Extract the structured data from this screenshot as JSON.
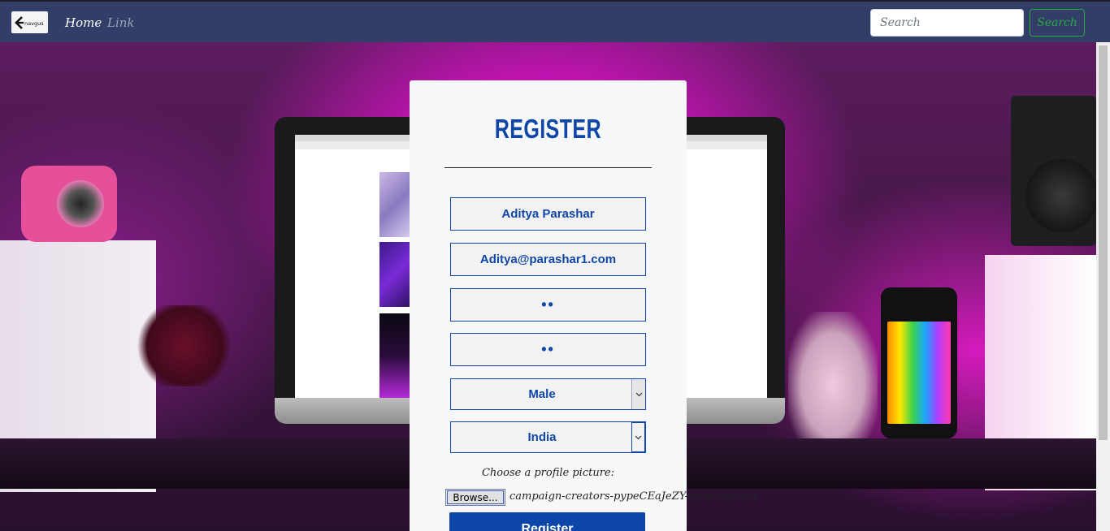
{
  "navbar": {
    "brand_text": "navgus",
    "home_label": "Home",
    "link_label": "Link",
    "search_placeholder": "Search",
    "search_button": "Search"
  },
  "form": {
    "title": "Register",
    "name_value": "Aditya Parashar",
    "email_value": "Aditya@parashar1.com",
    "password_mask": "••",
    "confirm_password_mask": "••",
    "gender_selected": "Male",
    "country_selected": "India",
    "file_label": "Choose a profile picture:",
    "browse_label": "Browse...",
    "file_name": "campaign-creators-pypeCEaJeZY-unsplash.jpg",
    "submit_label": "Register"
  },
  "colors": {
    "navbar_bg": "#323e67",
    "accent_blue": "#1046a7",
    "search_green": "#28a745",
    "card_bg": "#f7f8fa"
  },
  "icons": {
    "brand": "logo-icon",
    "select_arrow": "chevron-down-icon"
  }
}
